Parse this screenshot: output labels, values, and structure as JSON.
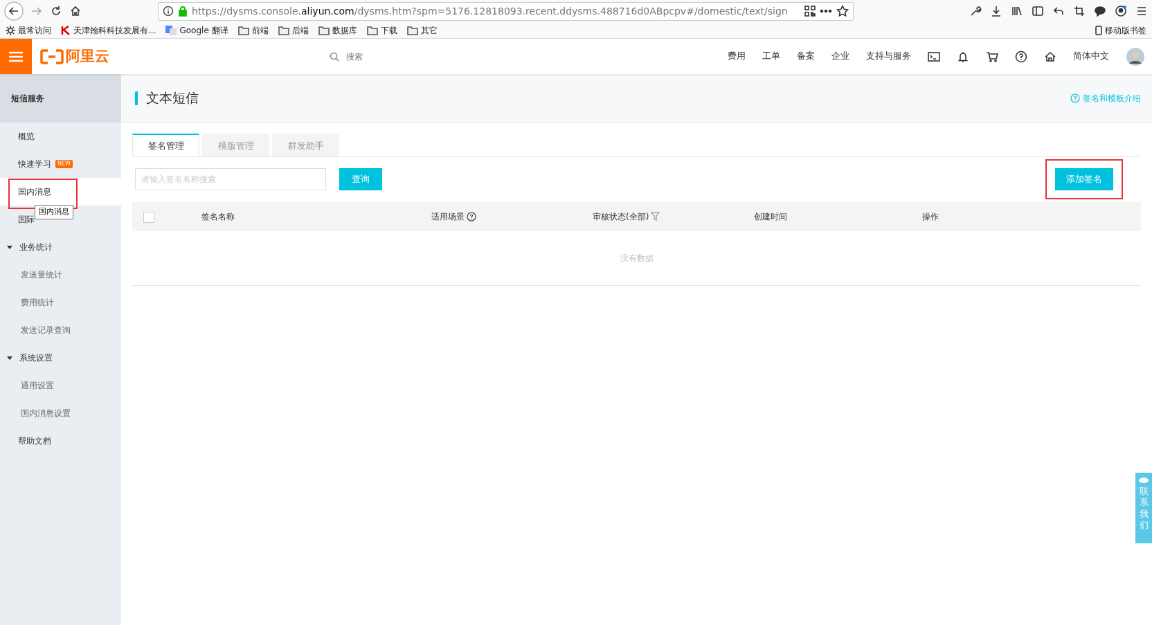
{
  "browser": {
    "url": {
      "start": "https://dysms.console.",
      "domain": "aliyun.com",
      "rest": "/dysms.htm?spm=5176.12818093.recent.ddysms.488716d0ABpcpv#/domestic/text/sign"
    },
    "bookmarks": [
      {
        "label": "最常访问",
        "kind": "settings"
      },
      {
        "label": "天津翰科科技发展有...",
        "kind": "site"
      },
      {
        "label": "Google 翻译",
        "kind": "translate"
      },
      {
        "label": "前端",
        "kind": "folder"
      },
      {
        "label": "后端",
        "kind": "folder"
      },
      {
        "label": "数据库",
        "kind": "folder"
      },
      {
        "label": "下载",
        "kind": "folder"
      },
      {
        "label": "其它",
        "kind": "folder"
      }
    ],
    "mobile_bookmarks": "移动版书签"
  },
  "header": {
    "logo_text": "阿里云",
    "search": {
      "placeholder": "搜索"
    },
    "nav": [
      "费用",
      "工单",
      "备案",
      "企业",
      "支持与服务"
    ],
    "language": "简体中文"
  },
  "sidebar": {
    "title": "短信服务",
    "items": [
      {
        "label": "概览",
        "kind": "item",
        "selected": false,
        "highlighted": false
      },
      {
        "label": "快速学习",
        "kind": "item",
        "selected": false,
        "highlighted": false,
        "badge": "NEW"
      },
      {
        "label": "国内消息",
        "kind": "item",
        "selected": true,
        "highlighted": true
      },
      {
        "label": "国际",
        "kind": "item",
        "selected": false,
        "highlighted": false
      },
      {
        "label": "业务统计",
        "kind": "group",
        "expanded": true,
        "children": [
          {
            "label": "发送量统计",
            "selected": false
          },
          {
            "label": "费用统计",
            "selected": false
          },
          {
            "label": "发送记录查询",
            "selected": false
          }
        ]
      },
      {
        "label": "系统设置",
        "kind": "group",
        "expanded": true,
        "children": [
          {
            "label": "通用设置",
            "selected": false
          },
          {
            "label": "国内消息设置",
            "selected": false
          }
        ]
      },
      {
        "label": "帮助文档",
        "kind": "item",
        "selected": false,
        "highlighted": false
      }
    ],
    "tooltip": "国内消息"
  },
  "page": {
    "title": "文本短信",
    "help_link": "签名和模板介绍",
    "tabs": [
      {
        "label": "签名管理",
        "selected": true
      },
      {
        "label": "模版管理",
        "selected": false
      },
      {
        "label": "群发助手",
        "selected": false
      }
    ],
    "search": {
      "placeholder": "请输入签名名称搜索"
    },
    "query_button": "查询",
    "add_button": {
      "label": "添加签名",
      "highlighted": true
    },
    "table": {
      "select_all_checked": false,
      "columns": [
        {
          "label": "签名名称",
          "kind": "plain"
        },
        {
          "label": "适用场景",
          "kind": "help"
        },
        {
          "label": "审核状态(全部)",
          "kind": "filter"
        },
        {
          "label": "创建时间",
          "kind": "plain"
        },
        {
          "label": "操作",
          "kind": "plain"
        }
      ],
      "empty_text": "没有数据"
    }
  },
  "contact": "联系我们"
}
